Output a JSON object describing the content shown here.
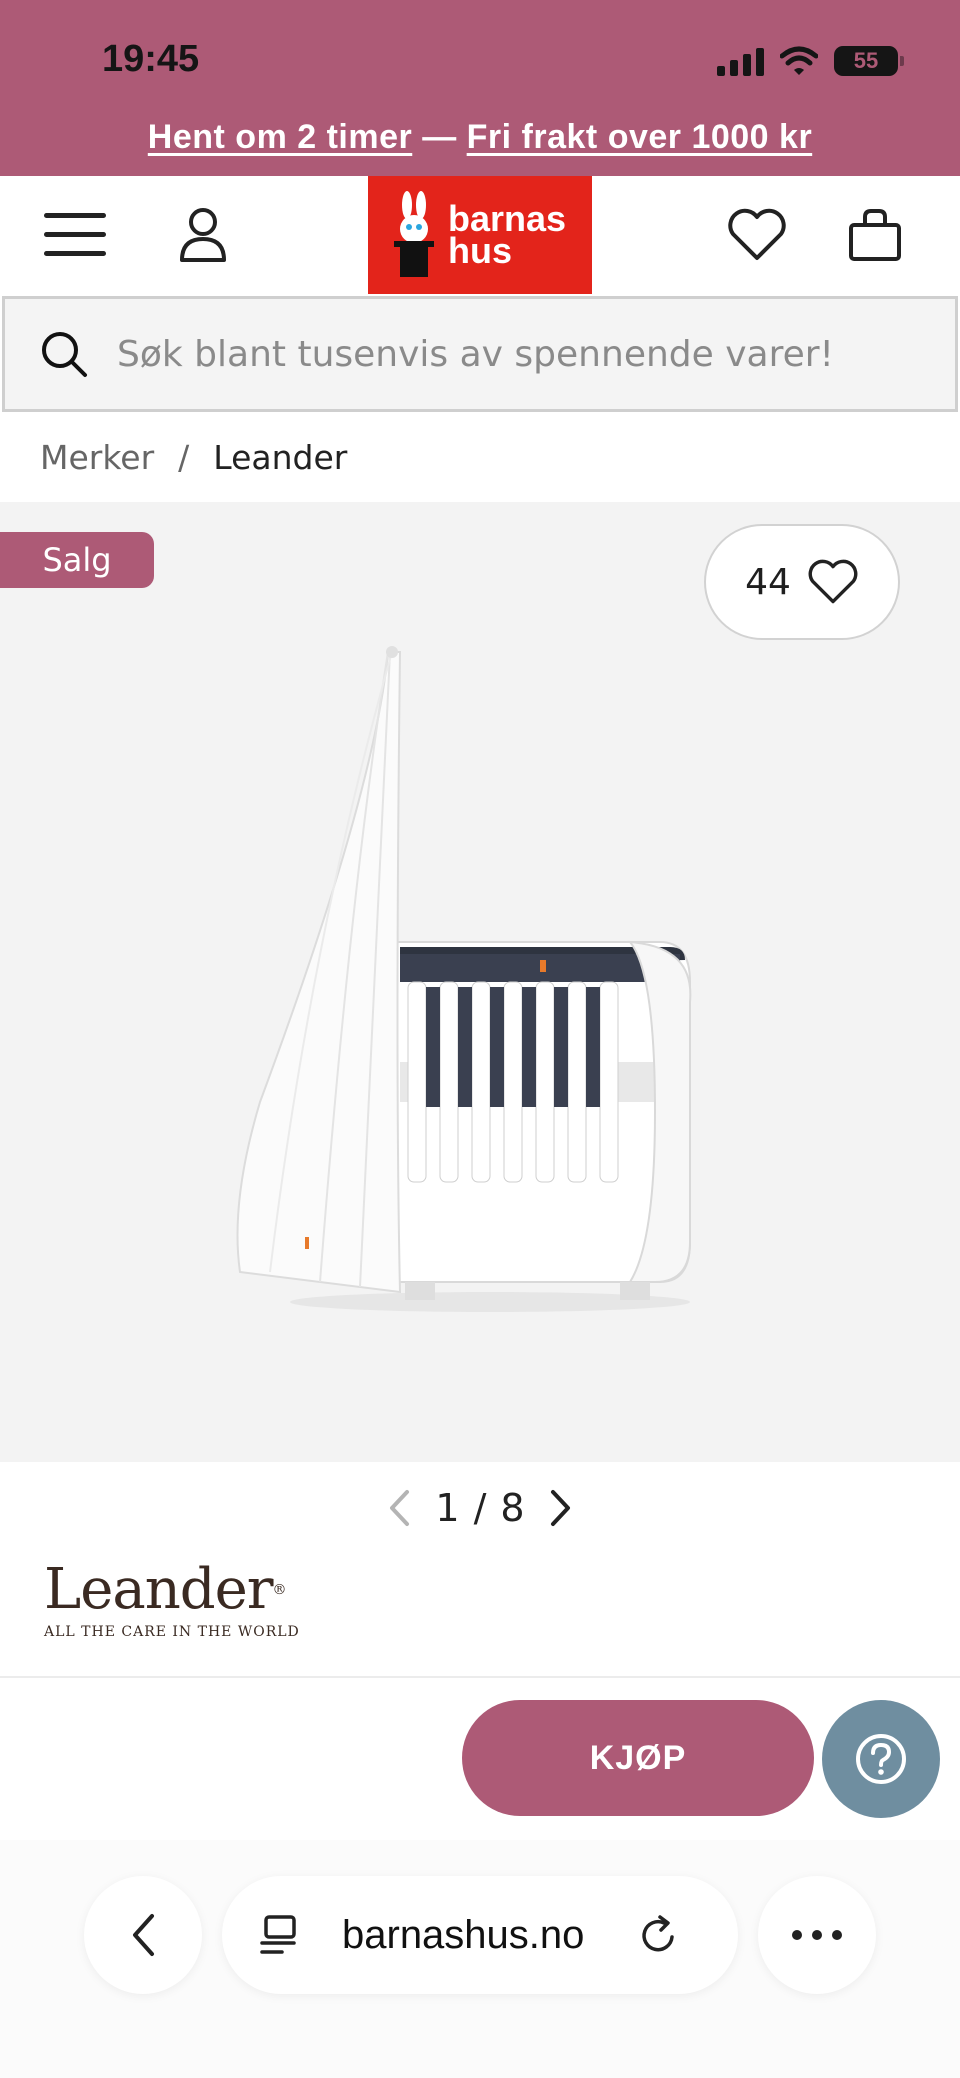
{
  "status_bar": {
    "time": "19:45",
    "battery": "55"
  },
  "promo": {
    "pickup_link": "Hent om 2 timer",
    "separator": "—",
    "shipping_link": "Fri frakt over 1000 kr"
  },
  "header": {
    "logo_line1": "barnas",
    "logo_line2": "hus",
    "icons": [
      "menu-icon",
      "account-icon",
      "heart-icon",
      "shopping-bag-icon"
    ]
  },
  "search": {
    "placeholder": "Søk blant tusenvis av spennende varer!",
    "value": ""
  },
  "breadcrumb": {
    "items": [
      "Merker",
      "Leander"
    ],
    "separator": "/"
  },
  "product": {
    "sale_badge": "Salg",
    "favorite_count": "44",
    "image_index": "1",
    "image_separator": "/",
    "image_total": "8"
  },
  "brand": {
    "name": "Leander",
    "tagline": "ALL THE CARE IN THE WORLD"
  },
  "actions": {
    "buy_label": "KJØP"
  },
  "browser": {
    "url": "barnashus.no"
  },
  "colors": {
    "accent": "#ad5a76",
    "logo_red": "#e3241b",
    "help_button": "#6f8ea0"
  }
}
